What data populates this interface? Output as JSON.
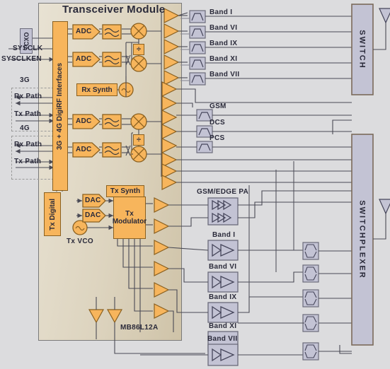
{
  "diagram": {
    "title": "Transceiver Module",
    "chip_label": "MB86L12A"
  },
  "left_io": {
    "tcxo": "TCXO",
    "sysclk": "SYSCLK",
    "sysclken": "SYSCLKEN",
    "group_3g": "3G",
    "group_4g": "4G",
    "rx_path_3g": "Rx Path",
    "tx_path_3g": "Tx Path",
    "rx_path_4g": "Rx Path",
    "tx_path_4g": "Tx Path",
    "digirf": "3G + 4G DigiRF Interfaces"
  },
  "rx_chain": {
    "adc": [
      "ADC",
      "ADC",
      "ADC",
      "ADC"
    ],
    "rx_synth": "Rx Synth",
    "divider": "÷"
  },
  "tx_chain": {
    "tx_digital": "Tx Digital",
    "dac": [
      "DAC",
      "DAC"
    ],
    "tx_synth": "Tx Synth",
    "tx_modulator": "Tx\nModulator",
    "tx_modulator_l1": "Tx",
    "tx_modulator_l2": "Modulator",
    "tx_vco": "Tx VCO"
  },
  "rx_filters_top": [
    {
      "label": "Band I"
    },
    {
      "label": "Band VI"
    },
    {
      "label": "Band IX"
    },
    {
      "label": "Band XI"
    },
    {
      "label": "Band VII"
    }
  ],
  "rx_filters_mid": [
    {
      "label": "GSM"
    },
    {
      "label": "DCS"
    },
    {
      "label": "PCS"
    }
  ],
  "pa_blocks": [
    {
      "label": "GSM/EDGE PA",
      "type": "dual"
    },
    {
      "label": "Band I",
      "type": "single"
    },
    {
      "label": "Band VI",
      "type": "single"
    },
    {
      "label": "Band IX",
      "type": "single"
    },
    {
      "label": "Band XI",
      "type": "single"
    },
    {
      "label": "Band VII",
      "type": "single"
    }
  ],
  "right_blocks": {
    "switch": "SWITCH",
    "switchplexer": "SWITCHPLEXER"
  },
  "colors": {
    "orange_fill": "#f7b55c",
    "orange_stroke": "#8a6020",
    "gray_fill": "#c3c3d4",
    "gray_stroke": "#6b6b7a",
    "module_bg": "#ddd4bf",
    "canvas_bg": "#dcdcde",
    "line": "#4a4a55",
    "text": "#2a2a3a"
  }
}
